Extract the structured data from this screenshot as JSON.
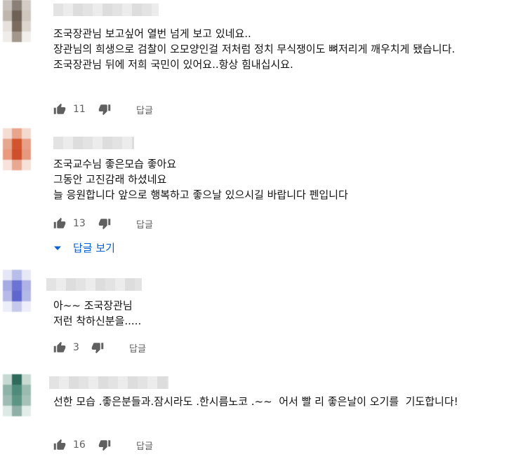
{
  "comments": [
    {
      "text": "조국장관님 보고싶어 열번 넘게 보고 있네요..\n장관님의 희생으로 검찰이 오모양인걸 저처럼 정치 무식쟁이도 뼈저리게 깨우치게 됐습니다.\n조국장관님 뒤에 저희 국민이 있어요..항상 힘내십시요.",
      "likes": "11",
      "reply_label": "답글",
      "avatar_colors": [
        "#c9c2bc",
        "#8a8078",
        "#d3ccc4",
        "#bfb7ae",
        "#6e6156",
        "#cfc6bd",
        "#e6e1dc",
        "#7b6c5f",
        "#ddd6cf",
        "#efecea",
        "#a3968b",
        "#f1eeeb"
      ]
    },
    {
      "text": "조국교수님 좋은모습 좋아요\n그동안 고진감래 하셨네요\n늘 응원합니다 앞으로 행복하고 좋으날 있으시길 바랍니다 펜입니다",
      "likes": "13",
      "reply_label": "답글",
      "view_replies_label": "답글 보기",
      "avatar_colors": [
        "#f5ddd4",
        "#e9a58c",
        "#f3d9ce",
        "#e6a68f",
        "#d2542f",
        "#e89f87",
        "#eb9a7f",
        "#cf4f2c",
        "#e59a80",
        "#f7e3db",
        "#e8a891",
        "#f6e1d9"
      ]
    },
    {
      "text": "아~~ 조국장관님\n저런 착하신분을.....",
      "likes": "3",
      "reply_label": "답글",
      "avatar_colors": [
        "#e6e7f6",
        "#b9bde9",
        "#e7e8f6",
        "#a6abe3",
        "#6d73d4",
        "#aeb2e5",
        "#b7bae7",
        "#5f66cd",
        "#b4b8e7",
        "#eceef8",
        "#c6c9ec",
        "#edeef9"
      ]
    },
    {
      "text": "선한 모습 .좋은분들과.잠시라도 .한시름노코 .~~  어서 빨 리 좋은날이 오기를  기도합니다!",
      "likes": "16",
      "reply_label": "답글",
      "avatar_colors": [
        "#c6dad3",
        "#2f6b5b",
        "#c8dbd3",
        "#8fb3a8",
        "#4f8b7a",
        "#9bbab0",
        "#9ebcb3",
        "#5d9584",
        "#a5c1b8",
        "#dde9e5",
        "#8fb0a6",
        "#e2ece8"
      ]
    }
  ]
}
